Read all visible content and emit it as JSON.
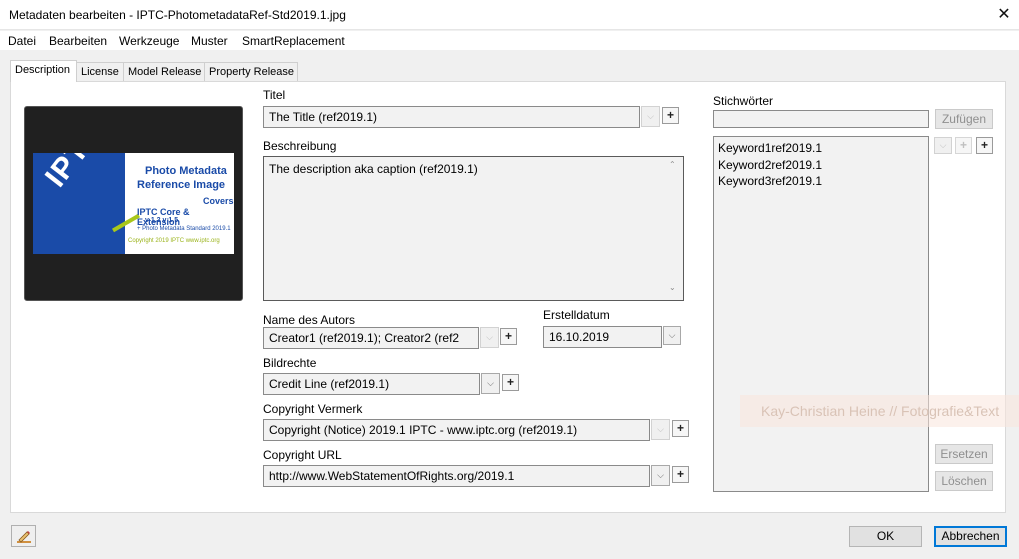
{
  "window": {
    "title": "Metadaten bearbeiten - IPTC-PhotometadataRef-Std2019.1.jpg",
    "close_glyph": "✕"
  },
  "menu": {
    "items": [
      "Datei",
      "Bearbeiten",
      "Werkzeuge",
      "Muster",
      "SmartReplacement"
    ]
  },
  "tabs": [
    {
      "label": "Description",
      "active": true
    },
    {
      "label": "License",
      "active": false
    },
    {
      "label": "Model Release",
      "active": false
    },
    {
      "label": "Property Release",
      "active": false
    }
  ],
  "thumbnail": {
    "logo_text": "IPTC",
    "line1": "Photo Metadata",
    "line2": "Reference Image",
    "line3": "Covers",
    "line4": "IPTC Core & Extension",
    "line5": "v 1.2            v 1.5",
    "line6": "+ Photo Metadata Standard 2019.1",
    "line7": "Copyright 2019 IPTC www.iptc.org"
  },
  "form": {
    "titel_label": "Titel",
    "titel_value": "The Title (ref2019.1)",
    "beschreibung_label": "Beschreibung",
    "beschreibung_value": "The description aka caption (ref2019.1)",
    "autor_label": "Name des Autors",
    "autor_value": "Creator1 (ref2019.1); Creator2 (ref2",
    "datum_label": "Erstelldatum",
    "datum_value": "16.10.2019",
    "bildrechte_label": "Bildrechte",
    "bildrechte_value": "Credit Line (ref2019.1)",
    "copyright_label": "Copyright Vermerk",
    "copyright_value": "Copyright (Notice) 2019.1 IPTC - www.iptc.org  (ref2019.1)",
    "copyright_url_label": "Copyright URL",
    "copyright_url_value": "http://www.WebStatementOfRights.org/2019.1"
  },
  "keywords": {
    "label": "Stichwörter",
    "input_value": "",
    "add_button": "Zufügen",
    "items": [
      "Keyword1ref2019.1",
      "Keyword2ref2019.1",
      "Keyword3ref2019.1"
    ],
    "replace_button": "Ersetzen",
    "delete_button": "Löschen"
  },
  "watermark": "Kay-Christian Heine // Fotografie&Text",
  "footer": {
    "ok_button": "OK",
    "cancel_button": "Abbrechen"
  },
  "glyphs": {
    "dropdown": "⌵",
    "plus": "+",
    "scroll_up": "⌃",
    "scroll_down": "⌄"
  },
  "colors": {
    "accent": "#0078d7",
    "iptc_blue": "#1a4ba8",
    "iptc_green": "#a8c71b"
  }
}
